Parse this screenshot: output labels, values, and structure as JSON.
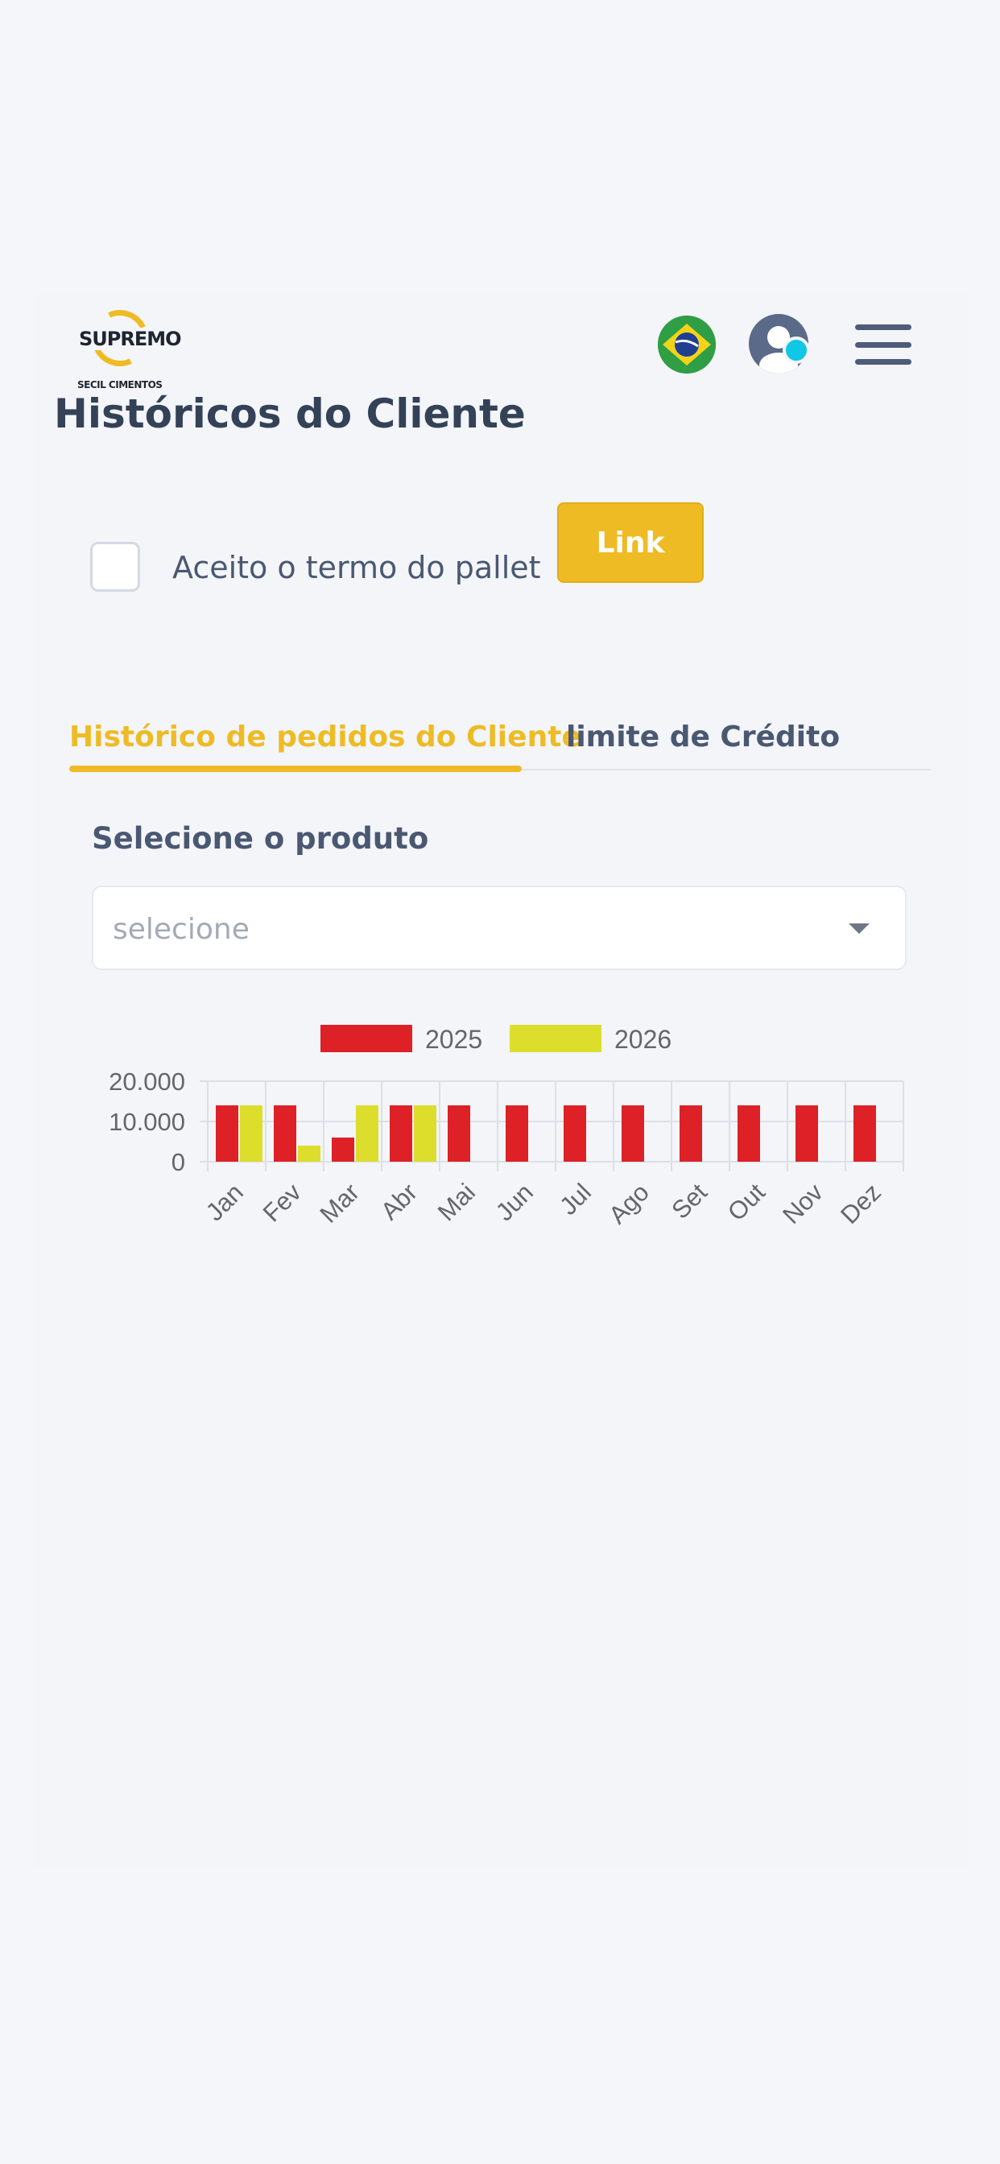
{
  "brand": {
    "name": "SUPREMO",
    "sub": "SECIL CIMENTOS"
  },
  "header": {
    "flag_icon": "brazil-flag-icon",
    "avatar_icon": "user-avatar-icon",
    "menu_icon": "hamburger-menu-icon"
  },
  "page": {
    "title": "Históricos do Cliente"
  },
  "terms": {
    "label": "Aceito o termo do pallet",
    "button": "Link",
    "checked": false
  },
  "tabs": [
    {
      "label": "Histórico de pedidos do Cliente",
      "active": true
    },
    {
      "label": "limite de Crédito",
      "active": false
    }
  ],
  "product": {
    "label": "Selecione o produto",
    "placeholder": "selecione"
  },
  "colors": {
    "accent": "#efbb25",
    "series_2025": "#dd2127",
    "series_2026": "#dddd2c"
  },
  "chart_data": {
    "type": "bar",
    "categories": [
      "Jan",
      "Fev",
      "Mar",
      "Abr",
      "Mai",
      "Jun",
      "Jul",
      "Ago",
      "Set",
      "Out",
      "Nov",
      "Dez"
    ],
    "series": [
      {
        "name": "2025",
        "values": [
          14000,
          14000,
          6000,
          14000,
          14000,
          14000,
          14000,
          14000,
          14000,
          14000,
          14000,
          14000
        ]
      },
      {
        "name": "2026",
        "values": [
          14000,
          4000,
          14000,
          14000,
          null,
          null,
          null,
          null,
          null,
          null,
          null,
          null
        ]
      }
    ],
    "y_ticks": [
      "20.000",
      "10.000",
      "0"
    ],
    "ylim": [
      0,
      20000
    ],
    "grid": true,
    "legend": "top-center"
  }
}
